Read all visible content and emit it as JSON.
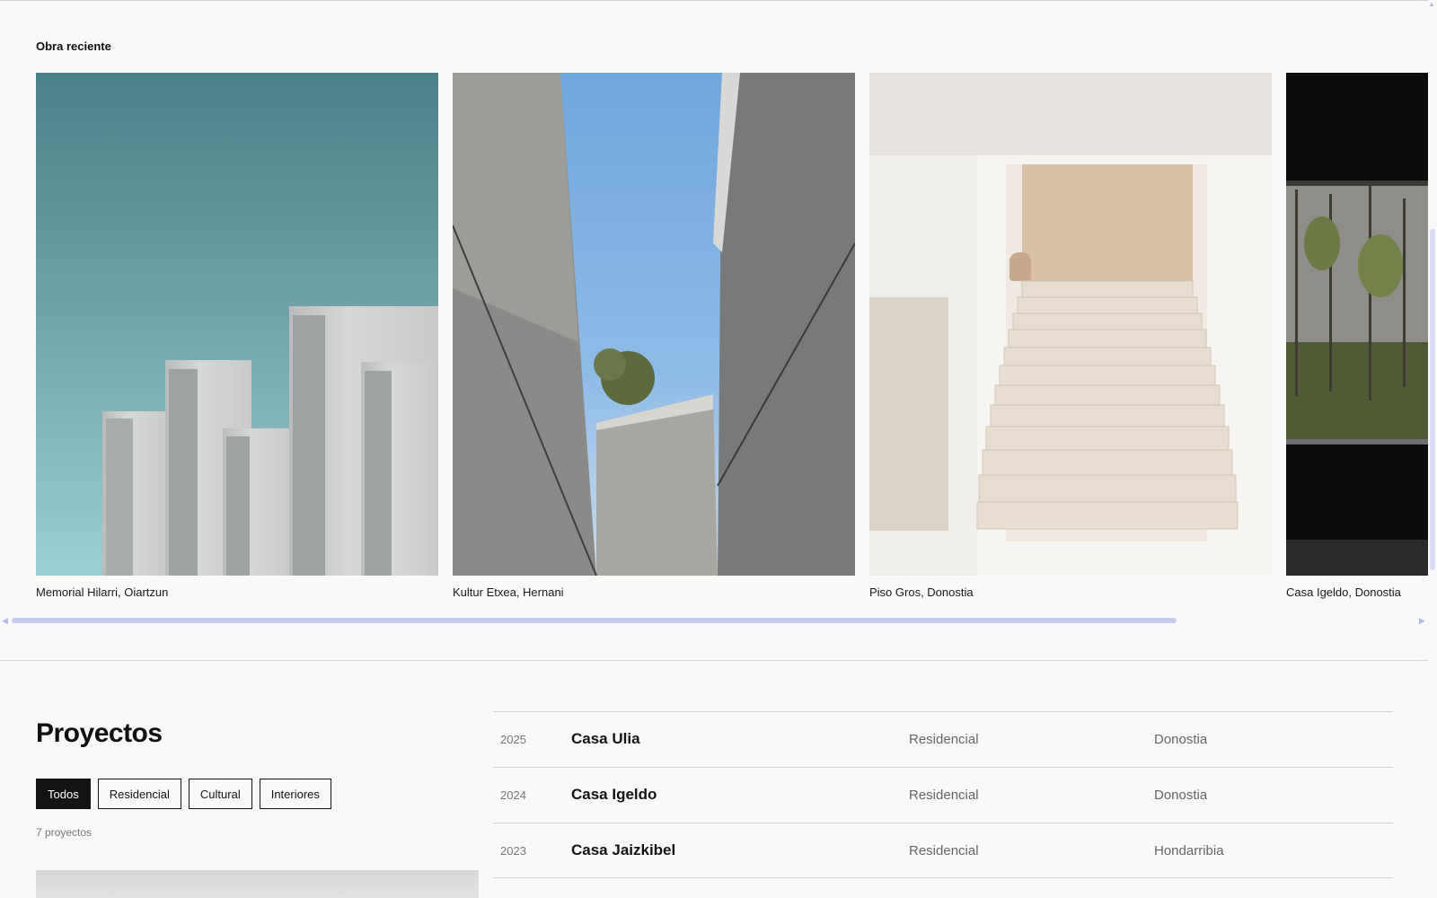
{
  "recent": {
    "title": "Obra reciente",
    "items": [
      {
        "caption": "Memorial Hilarri, Oiartzun"
      },
      {
        "caption": "Kultur Etxea, Hernani"
      },
      {
        "caption": "Piso Gros, Donostia"
      },
      {
        "caption": "Casa Igeldo, Donostia"
      }
    ]
  },
  "projects": {
    "title": "Proyectos",
    "filters": [
      "Todos",
      "Residencial",
      "Cultural",
      "Interiores"
    ],
    "active_filter": "Todos",
    "count": "7 proyectos",
    "rows": [
      {
        "year": "2025",
        "name": "Casa Ulia",
        "category": "Residencial",
        "location": "Donostia"
      },
      {
        "year": "2024",
        "name": "Casa Igeldo",
        "category": "Residencial",
        "location": "Donostia"
      },
      {
        "year": "2023",
        "name": "Casa Jaizkibel",
        "category": "Residencial",
        "location": "Hondarribia"
      }
    ]
  },
  "colors": {
    "background": "#f9f9f7",
    "ink": "#141414",
    "scroll_thumb": "#c7cbee"
  }
}
